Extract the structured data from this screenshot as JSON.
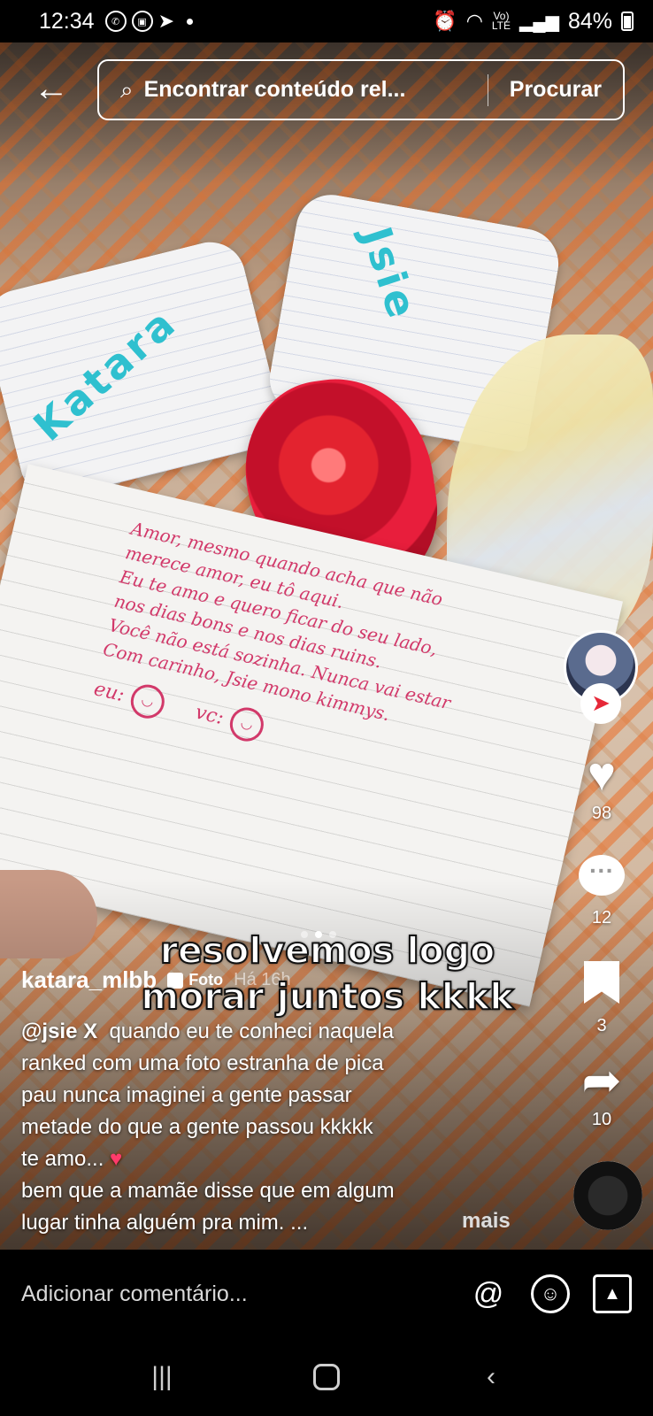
{
  "status_bar": {
    "time": "12:34",
    "battery": "84%",
    "network_top": "Vo)",
    "network_bottom": "LTE"
  },
  "search": {
    "placeholder": "Encontrar conteúdo rel...",
    "button_label": "Procurar"
  },
  "actions": {
    "likes": "98",
    "comments": "12",
    "saves": "3",
    "shares": "10"
  },
  "post": {
    "overlay_caption": "resolvemos logo morar juntos kkkk",
    "username": "katara_mlbb",
    "type_badge": "Foto",
    "time_ago": "Há 16h",
    "mention": "@jsie X",
    "caption_line1": "quando eu te conheci naquela",
    "caption_line2": "ranked com uma foto estranha de pica",
    "caption_line3": "pau nunca imaginei a gente passar",
    "caption_line4": "metade do que a gente passou kkkkk",
    "caption_line5": "te amo...",
    "caption_line6": "bem que a mamãe disse que em algum",
    "caption_line7": "lugar tinha alguém pra mim. ...",
    "more_label": "mais"
  },
  "photo": {
    "heart_left_text": "Katara",
    "heart_right_text": "Jsie",
    "note_lines": [
      "Amor, mesmo quando acha que não",
      "merece amor, eu tô aqui.",
      "Eu te amo e quero ficar do seu lado,",
      "nos dias bons e nos dias ruins.",
      "Você não está sozinha. Nunca vai estar",
      "Com carinho, Jsie mono kimmys."
    ],
    "note_eu": "eu:",
    "note_vc": "vc:"
  },
  "comment_bar": {
    "placeholder": "Adicionar comentário..."
  },
  "colors": {
    "accent_red": "#e62838",
    "ink_pink": "#d2396a",
    "heart_ink": "#2fc0cf"
  }
}
